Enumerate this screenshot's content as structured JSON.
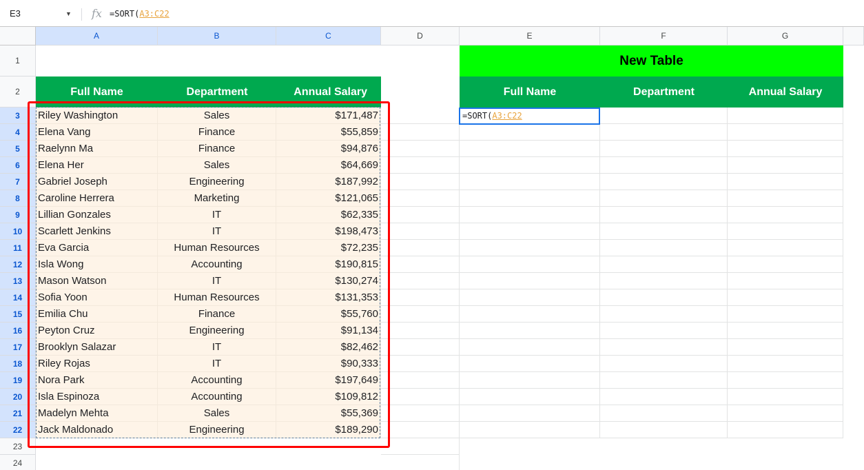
{
  "formula_bar": {
    "cell_ref": "E3",
    "fx": "fx",
    "formula_prefix": "=SORT(",
    "formula_range": "A3:C22"
  },
  "columns": [
    "A",
    "B",
    "C",
    "D",
    "E",
    "F",
    "G"
  ],
  "row_numbers": [
    "1",
    "2",
    "3",
    "4",
    "5",
    "6",
    "7",
    "8",
    "9",
    "10",
    "11",
    "12",
    "13",
    "14",
    "15",
    "16",
    "17",
    "18",
    "19",
    "20",
    "21",
    "22",
    "23",
    "24"
  ],
  "source_table": {
    "headers": [
      "Full Name",
      "Department",
      "Annual Salary"
    ],
    "rows": [
      [
        "Riley Washington",
        "Sales",
        "$171,487"
      ],
      [
        "Elena Vang",
        "Finance",
        "$55,859"
      ],
      [
        "Raelynn Ma",
        "Finance",
        "$94,876"
      ],
      [
        "Elena Her",
        "Sales",
        "$64,669"
      ],
      [
        "Gabriel Joseph",
        "Engineering",
        "$187,992"
      ],
      [
        "Caroline Herrera",
        "Marketing",
        "$121,065"
      ],
      [
        "Lillian Gonzales",
        "IT",
        "$62,335"
      ],
      [
        "Scarlett Jenkins",
        "IT",
        "$198,473"
      ],
      [
        "Eva Garcia",
        "Human Resources",
        "$72,235"
      ],
      [
        "Isla Wong",
        "Accounting",
        "$190,815"
      ],
      [
        "Mason Watson",
        "IT",
        "$130,274"
      ],
      [
        "Sofia Yoon",
        "Human Resources",
        "$131,353"
      ],
      [
        "Emilia Chu",
        "Finance",
        "$55,760"
      ],
      [
        "Peyton Cruz",
        "Engineering",
        "$91,134"
      ],
      [
        "Brooklyn Salazar",
        "IT",
        "$82,462"
      ],
      [
        "Riley Rojas",
        "IT",
        "$90,333"
      ],
      [
        "Nora Park",
        "Accounting",
        "$197,649"
      ],
      [
        "Isla Espinoza",
        "Accounting",
        "$109,812"
      ],
      [
        "Madelyn Mehta",
        "Sales",
        "$55,369"
      ],
      [
        "Jack Maldonado",
        "Engineering",
        "$189,290"
      ]
    ]
  },
  "new_table": {
    "title": "New Table",
    "headers": [
      "Full Name",
      "Department",
      "Annual Salary"
    ],
    "editing_cell": {
      "prefix": "=SORT(",
      "range": "A3:C22"
    }
  },
  "colors": {
    "header_green": "#00a94f",
    "title_green": "#00ff00",
    "data_fill": "#fef4e8",
    "highlight_red": "#ff0000",
    "range_orange": "#e8a33d",
    "selection_blue": "#1a73e8"
  }
}
